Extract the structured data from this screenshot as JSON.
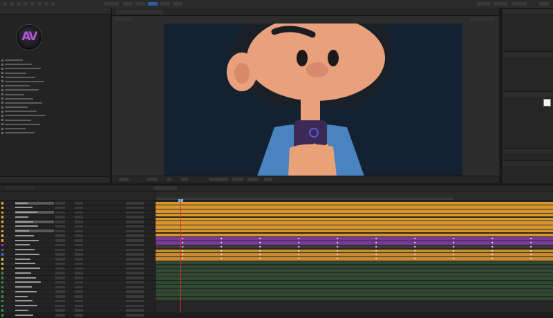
{
  "app": {
    "accent": "#2d8ceb",
    "layer_colors": [
      "#e8a33a",
      "#8a3fa8",
      "#2f6ed0",
      "#d8c24a",
      "#3d8a3d",
      "#b64545"
    ]
  },
  "toolbar": {
    "icons": [
      "selection-tool-icon",
      "hand-tool-icon",
      "zoom-tool-icon",
      "rotate-tool-icon",
      "camera-tool-icon",
      "pen-tool-icon",
      "type-tool-icon",
      "brush-tool-icon",
      "puppet-tool-icon"
    ]
  },
  "project": {
    "logo_text": "AV"
  },
  "viewer": {
    "icons": [
      "zoom-menu-icon",
      "resolution-icon",
      "grid-icon",
      "camera-icon",
      "channel-icon",
      "view-options-icon"
    ]
  },
  "right_panels": {
    "icons": [
      "info-icon",
      "effects-presets-icon",
      "character-icon",
      "paragraph-icon",
      "align-icon"
    ]
  },
  "timeline": {
    "current_time_marker": "cti-marker",
    "layer_count": 25
  }
}
